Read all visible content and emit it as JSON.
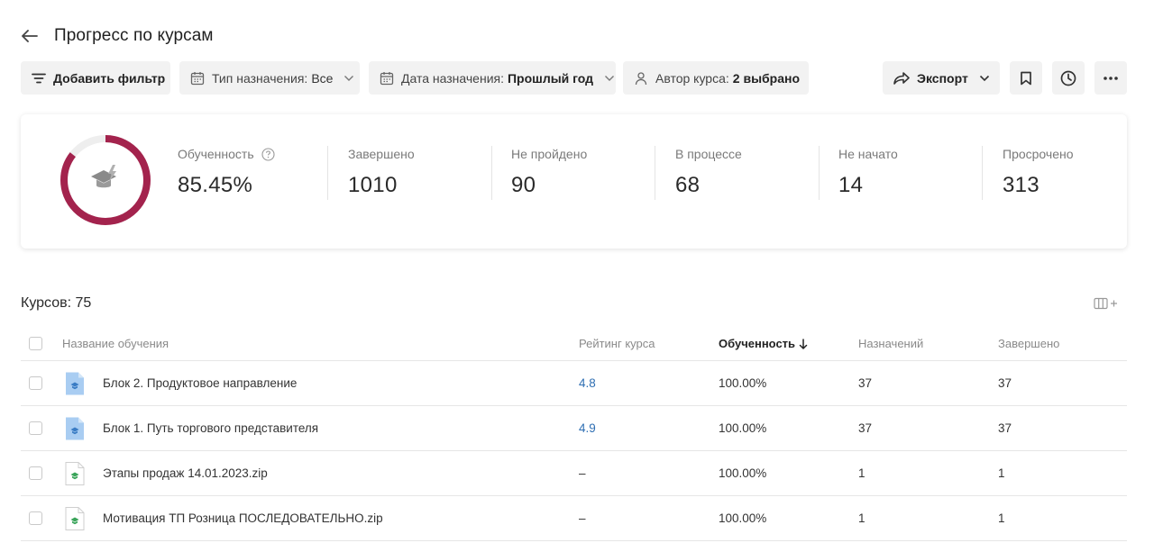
{
  "header": {
    "title": "Прогресс по курсам"
  },
  "filters": {
    "add_filter": "Добавить фильтр",
    "assignment_type": {
      "label": "Тип назначения:",
      "value": "Все"
    },
    "assignment_date": {
      "label": "Дата назначения:",
      "value": "Прошлый год"
    },
    "course_author": {
      "label": "Автор курса:",
      "value": "2 выбрано"
    },
    "export": "Экспорт"
  },
  "stats": {
    "progress_fraction": 0.8545,
    "ring_color": "#a3234d",
    "items": [
      {
        "label": "Обученность",
        "value": "85.45%"
      },
      {
        "label": "Завершено",
        "value": "1010"
      },
      {
        "label": "Не пройдено",
        "value": "90"
      },
      {
        "label": "В процессе",
        "value": "68"
      },
      {
        "label": "Не начато",
        "value": "14"
      },
      {
        "label": "Просрочено",
        "value": "313"
      }
    ]
  },
  "table": {
    "count_label": "Курсов: 75",
    "columns": {
      "name": "Название обучения",
      "rating": "Рейтинг курса",
      "progress": "Обученность",
      "assigned": "Назначений",
      "completed": "Завершено"
    },
    "rows": [
      {
        "icon": "blue-course-file-icon",
        "name": "Блок 2. Продуктовое направление",
        "rating": "4.8",
        "progress": "100.00%",
        "assigned": "37",
        "completed": "37"
      },
      {
        "icon": "blue-course-file-icon",
        "name": "Блок 1. Путь торгового представителя",
        "rating": "4.9",
        "progress": "100.00%",
        "assigned": "37",
        "completed": "37"
      },
      {
        "icon": "green-scorm-file-icon",
        "name": "Этапы продаж 14.01.2023.zip",
        "rating": "–",
        "progress": "100.00%",
        "assigned": "1",
        "completed": "1"
      },
      {
        "icon": "green-scorm-file-icon",
        "name": "Мотивация ТП Розница ПОСЛЕДОВАТЕЛЬНО.zip",
        "rating": "–",
        "progress": "100.00%",
        "assigned": "1",
        "completed": "1"
      }
    ]
  }
}
